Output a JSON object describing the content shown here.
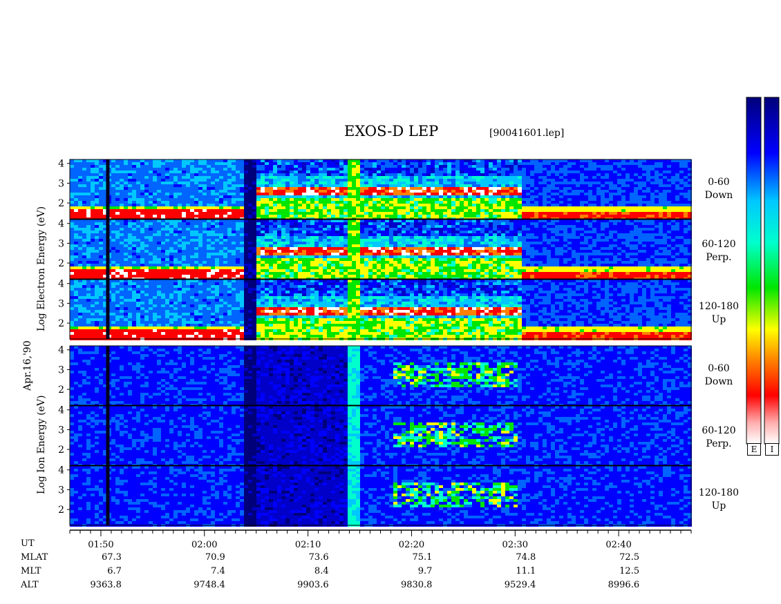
{
  "title": "EXOS-D LEP",
  "file_id": "[90041601.lep]",
  "date_label": "Apr.16,'90",
  "electron_group": {
    "ylabel": "Log  Electron  Energy (eV)"
  },
  "ion_group": {
    "ylabel": "Log  Ion  Energy (eV)"
  },
  "panels": [
    {
      "species": "electron",
      "channel": "0-60",
      "direction": "Down"
    },
    {
      "species": "electron",
      "channel": "60-120",
      "direction": "Perp."
    },
    {
      "species": "electron",
      "channel": "120-180",
      "direction": "Up"
    },
    {
      "species": "ion",
      "channel": "0-60",
      "direction": "Down"
    },
    {
      "species": "ion",
      "channel": "60-120",
      "direction": "Perp."
    },
    {
      "species": "ion",
      "channel": "120-180",
      "direction": "Up"
    }
  ],
  "colorbar": {
    "labels": [
      "E",
      "I"
    ],
    "colors": [
      "#00007a",
      "#0000ff",
      "#00c8ff",
      "#00ff99",
      "#00e600",
      "#ffff00",
      "#ff8000",
      "#ff0000",
      "#ffffff"
    ]
  },
  "chart_data": {
    "type": "heatmap",
    "title": "EXOS-D LEP",
    "ylabel_electron": "Log  Electron  Energy (eV)",
    "ylabel_ion": "Log  Ion  Energy (eV)",
    "y_ticks": [
      "4",
      "3",
      "2"
    ],
    "ylim": [
      1.2,
      4.2
    ],
    "x_ticks": [
      "01:50",
      "02:00",
      "02:10",
      "02:20",
      "02:30",
      "02:40"
    ],
    "x_range": [
      "01:47",
      "02:47"
    ],
    "ephemeris": {
      "row_labels": [
        "UT",
        "MLAT",
        "MLT",
        "ALT"
      ],
      "MLAT": [
        "67.3",
        "70.9",
        "73.6",
        "75.1",
        "74.8",
        "72.5"
      ],
      "MLT": [
        "6.7",
        "7.4",
        "8.4",
        "9.7",
        "11.1",
        "12.5"
      ],
      "ALT": [
        "9363.8",
        "9748.4",
        "9903.6",
        "9830.8",
        "9529.4",
        "8996.6"
      ]
    },
    "events": {
      "data_gap_ut": [
        "02:03.5",
        "02:05"
      ],
      "electron_intense_region_ut": [
        "02:05",
        "02:30.5"
      ],
      "ion_conic_region_ut": [
        "02:18",
        "02:30"
      ]
    }
  }
}
